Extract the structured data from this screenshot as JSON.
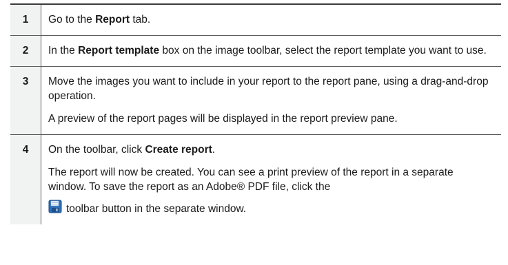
{
  "steps": [
    {
      "number": "1",
      "text_before": "Go to the ",
      "bold": "Report",
      "text_after": " tab."
    },
    {
      "number": "2",
      "text_before": "In the ",
      "bold": "Report template",
      "text_after": " box on the image toolbar, select the report template you want to use."
    },
    {
      "number": "3",
      "line1": "Move the images you want to include in your report to the report pane, using a drag-and-drop operation.",
      "line2": "A preview of the report pages will be displayed in the report preview pane."
    },
    {
      "number": "4",
      "text_before": "On the toolbar, click ",
      "bold": "Create report",
      "text_after": ".",
      "line2": "The report will now be created. You can see a print preview of the report in a separate window. To save the report as an Adobe® PDF file, click the",
      "line3": "toolbar button in the separate window.",
      "icon": "save-floppy-icon"
    }
  ]
}
